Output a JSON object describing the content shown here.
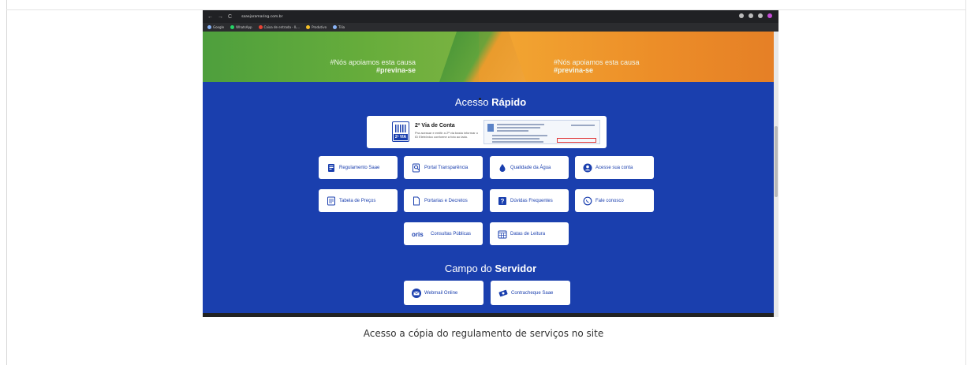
{
  "browser": {
    "url": "saaejaramaring.com.br",
    "bookmarks": [
      "Google",
      "WhatsApp",
      "Caixa de entrada - IL...",
      "Produtivo",
      "Tilia"
    ]
  },
  "hero": {
    "left_line1": "#Nós apoiamos esta causa",
    "left_line2": "#previna-se",
    "right_line1": "#Nós apoiamos esta causa",
    "right_line2": "#previna-se"
  },
  "acesso": {
    "title_light": "Acesso",
    "title_bold": "Rápido",
    "card_title": "2ª Via de Conta",
    "card_text": "Pra acessar e emitir a 2ª via basta informar o ID Eletrônico conforme a foto ao lado.",
    "badge": "2ª VIA"
  },
  "quick_links": [
    {
      "label": "Regulamento Saae",
      "icon": "document-icon"
    },
    {
      "label": "Portal Transparência",
      "icon": "search-document-icon"
    },
    {
      "label": "Qualidade da Água",
      "icon": "water-drop-icon"
    },
    {
      "label": "Acesse sua conta",
      "icon": "user-icon"
    },
    {
      "label": "Tabela de Preços",
      "icon": "price-table-icon"
    },
    {
      "label": "Portarias e Decretos",
      "icon": "file-icon"
    },
    {
      "label": "Dúvidas Frequentes",
      "icon": "question-icon"
    },
    {
      "label": "Fale conosco",
      "icon": "whatsapp-icon"
    },
    {
      "label": "Consultas Públicas",
      "icon": "oris-logo"
    },
    {
      "label": "Datas de Leitura",
      "icon": "calendar-icon"
    }
  ],
  "servidor": {
    "title_light": "Campo do",
    "title_bold": "Servidor",
    "links": [
      {
        "label": "Webmail Online",
        "icon": "mail-icon"
      },
      {
        "label": "Contracheque Saae",
        "icon": "money-icon"
      }
    ]
  },
  "caption": "Acesso a cópia do regulamento de serviços no site",
  "colors": {
    "brand_blue": "#1a3fae",
    "hero_green": "#5ea23b",
    "hero_orange": "#ec8d28"
  }
}
